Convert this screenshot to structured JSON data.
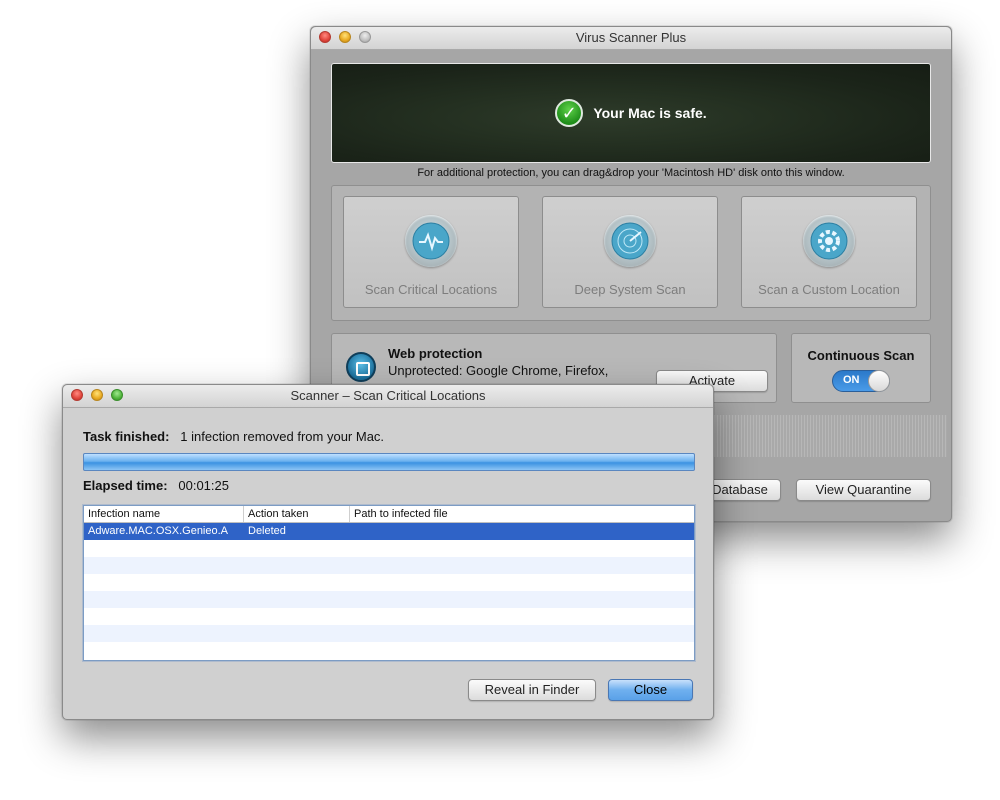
{
  "main_window": {
    "title": "Virus Scanner Plus",
    "status_text": "Your Mac is safe.",
    "hint_text": "For additional protection, you can drag&drop your 'Macintosh HD' disk onto this window.",
    "scan_buttons": [
      {
        "label": "Scan Critical Locations",
        "icon": "pulse-icon"
      },
      {
        "label": "Deep System Scan",
        "icon": "radar-icon"
      },
      {
        "label": "Scan a Custom Location",
        "icon": "gear-icon"
      }
    ],
    "web_protection": {
      "title": "Web protection",
      "detail": "Unprotected: Google Chrome, Firefox,",
      "activate_label": "Activate"
    },
    "continuous_scan": {
      "title": "Continuous Scan",
      "toggle_label": "ON"
    },
    "update_database_label": "Database",
    "view_quarantine_label": "View Quarantine"
  },
  "scanner_window": {
    "title": "Scanner – Scan Critical Locations",
    "task_label": "Task finished:",
    "task_value": "1 infection removed from your Mac.",
    "progress": 1.0,
    "elapsed_label": "Elapsed time:",
    "elapsed_value": "00:01:25",
    "table": {
      "columns": [
        "Infection name",
        "Action taken",
        "Path to infected file"
      ],
      "rows": [
        [
          "Adware.MAC.OSX.Genieo.A",
          "Deleted",
          ""
        ]
      ]
    },
    "reveal_label": "Reveal in Finder",
    "close_label": "Close"
  },
  "colors": {
    "accent": "#5aa1e8",
    "selection": "#2f63c7",
    "safe_green": "#1f8e1a"
  }
}
